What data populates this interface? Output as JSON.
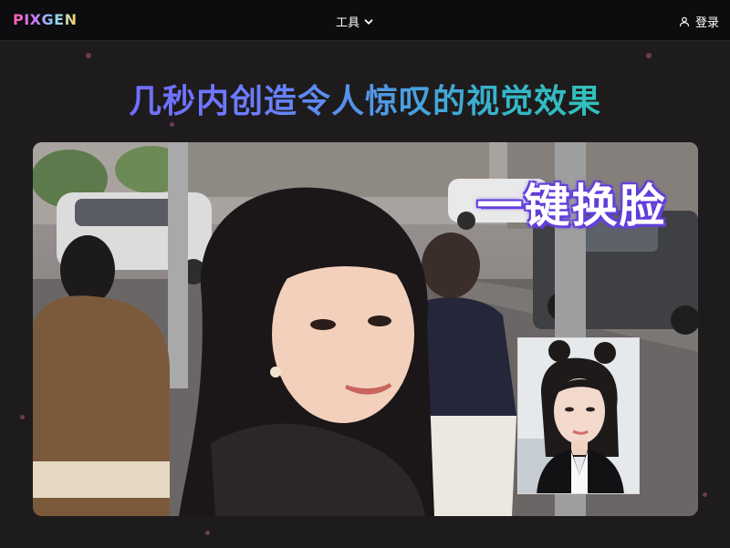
{
  "header": {
    "logo_text": "PIXGEN",
    "nav_tools_label": "工具",
    "login_label": "登录"
  },
  "hero": {
    "headline": "几秒内创造令人惊叹的视觉效果",
    "badge_text": "一键换脸"
  },
  "icons": [
    "chevron-down-icon",
    "user-icon"
  ],
  "colors": {
    "page_bg": "#1e1b1d",
    "topbar_bg": "#0d0c0e",
    "headline_gradient": [
      "#7a5cff",
      "#34b6c8",
      "#2fd3a0"
    ],
    "badge_outline": "#6a44e0"
  }
}
